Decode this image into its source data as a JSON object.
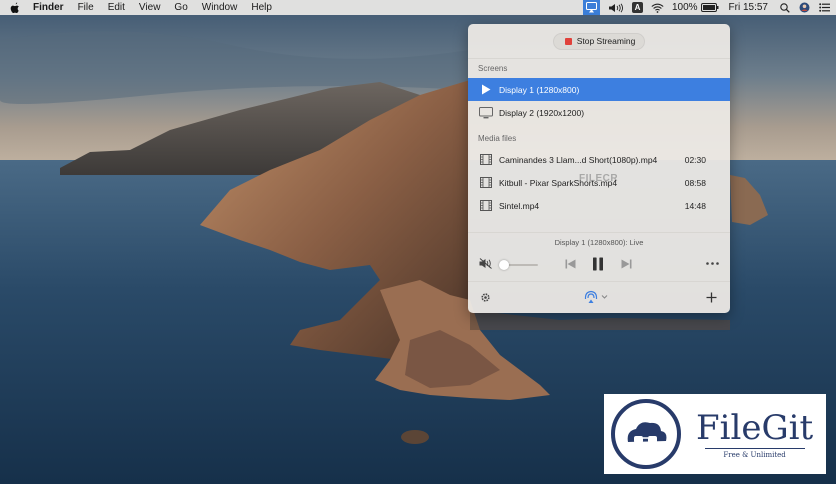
{
  "menubar": {
    "app_name": "Finder",
    "menus": [
      "File",
      "Edit",
      "View",
      "Go",
      "Window",
      "Help"
    ],
    "battery": "100%",
    "clock": "Fri 15:57"
  },
  "panel": {
    "stop_button": "Stop Streaming",
    "screens_label": "Screens",
    "screens": [
      {
        "label": "Display 1 (1280x800)",
        "icon": "play-icon"
      },
      {
        "label": "Display 2 (1920x1200)",
        "icon": "monitor-icon"
      }
    ],
    "media_label": "Media files",
    "media": [
      {
        "label": "Caminandes 3  Llam...d Short(1080p).mp4",
        "duration": "02:30"
      },
      {
        "label": "Kitbull - Pixar SparkShorts.mp4",
        "duration": "08:58"
      },
      {
        "label": "Sintel.mp4",
        "duration": "14:48"
      }
    ],
    "now_playing": "Display 1 (1280x800): Live",
    "volume": 0,
    "colors": {
      "accent": "#3d7fe0",
      "stop": "#e0413b"
    }
  },
  "watermarks": {
    "filecr": "FILECR",
    "filegit_name": "FileGit",
    "filegit_tag": "Free & Unlimited"
  }
}
